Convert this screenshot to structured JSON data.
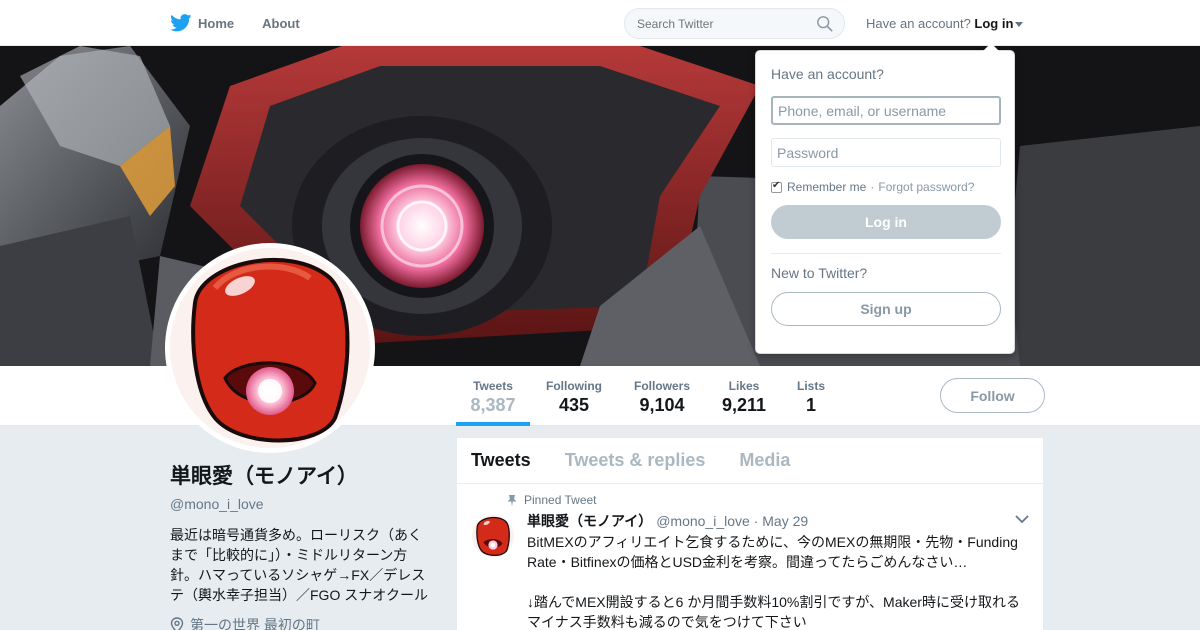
{
  "nav": {
    "home_label": "Home",
    "about_label": "About",
    "search_placeholder": "Search Twitter",
    "account_prefix": "Have an account?",
    "login_label": "Log in"
  },
  "profile_nav": {
    "stats": [
      {
        "label": "Tweets",
        "value": "8,387"
      },
      {
        "label": "Following",
        "value": "435"
      },
      {
        "label": "Followers",
        "value": "9,104"
      },
      {
        "label": "Likes",
        "value": "9,211"
      },
      {
        "label": "Lists",
        "value": "1"
      }
    ],
    "follow_label": "Follow"
  },
  "profile": {
    "name": "単眼愛（モノアイ）",
    "handle": "@mono_i_love",
    "bio": "最近は暗号通貨多め。ローリスク（あくまで「比較的に」）・ミドルリターン方針。ハマっているソシャゲ→FX／デレステ（輿水幸子担当）／FGO スナオクール",
    "location": "第一の世界 最初の町"
  },
  "timeline": {
    "tabs": [
      "Tweets",
      "Tweets & replies",
      "Media"
    ],
    "tweet": {
      "pinned_label": "Pinned Tweet",
      "name": "単眼愛（モノアイ）",
      "handle": "@mono_i_love",
      "date": "May 29",
      "text": "BitMEXのアフィリエイト乞食するために、今のMEXの無期限・先物・Funding Rate・Bitfinexの価格とUSD金利を考察。間違ってたらごめんなさい…\n\n↓踏んでMEX開設すると6 か月間手数料10%割引ですが、Maker時に受け取れるマイナス手数料も減るので気をつけて下さい"
    }
  },
  "login_dropdown": {
    "title": "Have an account?",
    "username_placeholder": "Phone, email, or username",
    "password_placeholder": "Password",
    "remember_label": "Remember me",
    "separator": "·",
    "forgot_label": "Forgot password?",
    "login_button": "Log in",
    "new_label": "New to Twitter?",
    "signup_button": "Sign up"
  },
  "colors": {
    "accent": "#1da1f2",
    "background": "#e6ecf0",
    "muted": "#657786",
    "monoeye_red": "#d42a1a",
    "monoeye_glow": "#f6a0c0"
  }
}
